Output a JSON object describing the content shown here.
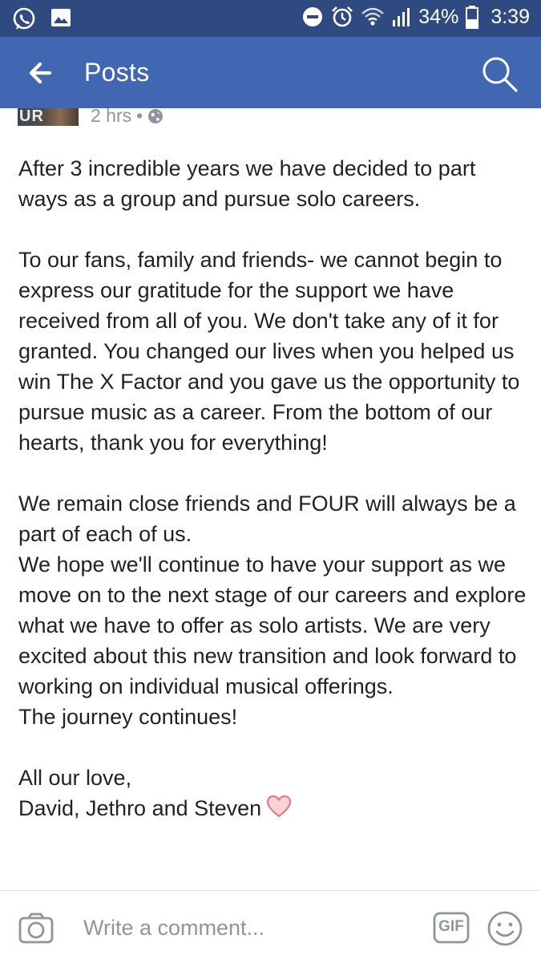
{
  "status_bar": {
    "battery_text": "34%",
    "time": "3:39",
    "icons": [
      "whatsapp-icon",
      "gallery-icon",
      "do-not-disturb-icon",
      "alarm-icon",
      "wifi-icon",
      "signal-icon",
      "battery-icon"
    ]
  },
  "app_bar": {
    "title": "Posts",
    "back_icon": "back-arrow-icon",
    "search_icon": "search-icon",
    "background": "#4267b2"
  },
  "post": {
    "avatar_text": "UR",
    "time": "2 hrs",
    "separator": "•",
    "privacy_icon": "globe-icon",
    "paragraphs": [
      "After 3 incredible years we have decided to part ways as a group and pursue solo careers.",
      "To our fans, family and friends- we cannot begin to express our gratitude for the support we have received from all of you. We don't take any of it for granted. You changed our lives when you helped us win The X Factor and you gave us the opportunity to pursue music as a career. From the bottom of our hearts, thank you for everything!",
      "We remain close friends and FOUR will always be a part of each of us."
    ],
    "lines": [
      "We hope we'll continue to have your support as we move on to the next stage of our careers and explore what we have to offer as solo artists. We are very excited about this new transition and look forward to working on individual musical offerings.",
      "The journey continues!"
    ],
    "signoff": "All our love,",
    "signature": "David, Jethro and Steven",
    "heart_icon": "heart-icon"
  },
  "comment_bar": {
    "placeholder": "Write a comment...",
    "camera_icon": "camera-icon",
    "gif_label": "GIF",
    "emoji_icon": "smiley-icon"
  }
}
